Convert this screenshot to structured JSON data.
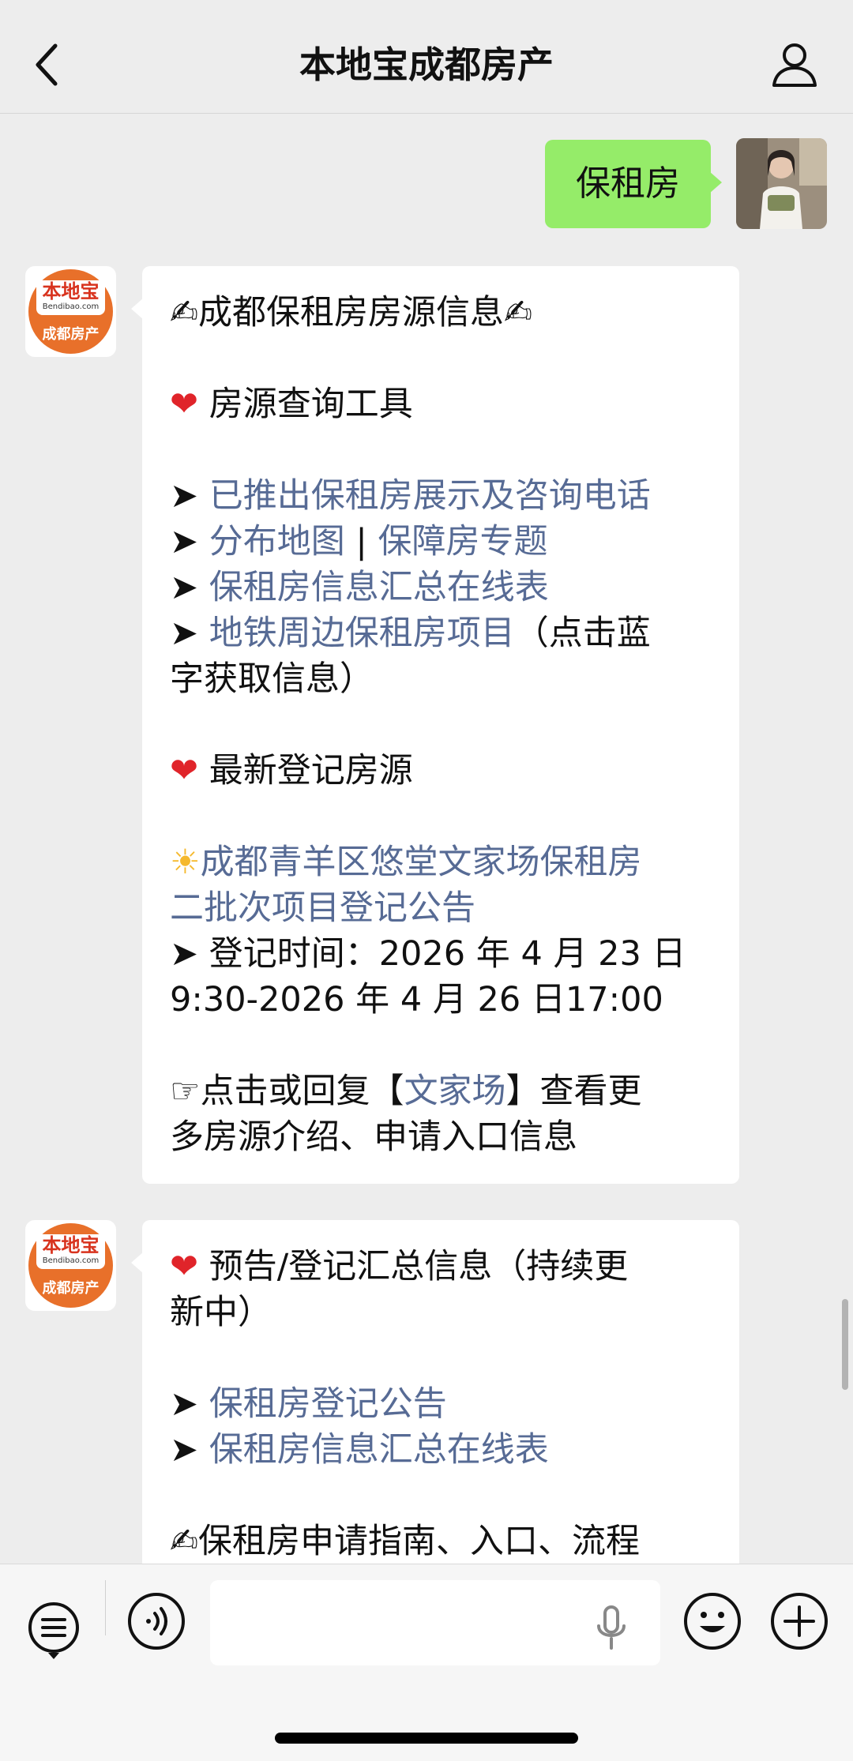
{
  "header": {
    "title": "本地宝成都房产"
  },
  "user_message": {
    "text": "保租房"
  },
  "bot_avatar": {
    "brand": "本地宝",
    "domain": "Bendibao.com",
    "city": "成都房产"
  },
  "message1": {
    "title": "成都保租房房源信息",
    "section1_heading": "房源查询工具",
    "link1": "已推出保租房展示及咨询电话",
    "link2": "分布地图",
    "sep": " | ",
    "link3": "保障房专题",
    "link4": "保租房信息汇总在线表",
    "link5": "地铁周边保租房项目",
    "link5_suffix": "（点击蓝",
    "link5_suffix2": "字获取信息）",
    "section2_heading": "最新登记房源",
    "project_line1": "成都青羊区悠堂文家场保租房",
    "project_line2": "二批次项目登记公告",
    "time_line1": "登记时间：2026 年 4 月 23 日",
    "time_line2": "9:30-2026 年 4 月 26 日17:00",
    "cta_prefix": "点击或回复【",
    "cta_link": "文家场",
    "cta_suffix": "】查看更",
    "cta_line2": "多房源介绍、申请入口信息"
  },
  "message2": {
    "heading_line1": "预告/登记汇总信息（持续更",
    "heading_line2": "新中）",
    "link1": "保租房登记公告",
    "link2": "保租房信息汇总在线表",
    "guide": "保租房申请指南、入口、流程"
  },
  "icons": {
    "writing_hand": "✍",
    "heart": "❤",
    "arrow": "➤",
    "sun": "☀",
    "pointing_hand": "☞"
  }
}
